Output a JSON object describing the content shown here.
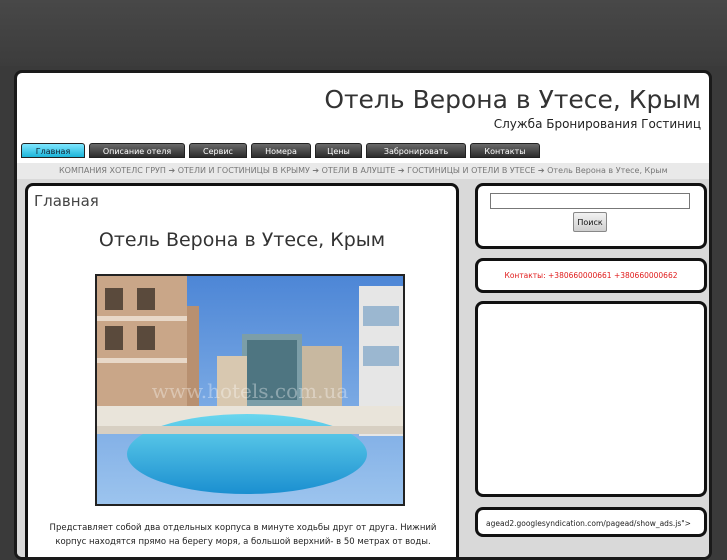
{
  "header": {
    "title": "Отель Верона в Утесе, Крым",
    "subtitle": "Служба Бронирования Гостиниц"
  },
  "nav": {
    "items": [
      {
        "label": "Главная",
        "active": true
      },
      {
        "label": "Описание отеля",
        "active": false
      },
      {
        "label": "Сервис",
        "active": false
      },
      {
        "label": "Номера",
        "active": false
      },
      {
        "label": "Цены",
        "active": false
      },
      {
        "label": "Забронировать",
        "active": false
      },
      {
        "label": "Контакты",
        "active": false
      }
    ]
  },
  "breadcrumb": {
    "text": "КОМПАНИЯ ХОТЕЛС ГРУП  ➔ ОТЕЛИ И ГОСТИНИЦЫ В КРЫМУ  ➔ ОТЕЛИ В АЛУШТЕ ➔ ГОСТИНИЦЫ И ОТЕЛИ В УТЕСЕ ➔ Отель Верона в Утесе, Крым"
  },
  "main": {
    "heading": "Главная",
    "hotel_title": "Отель Верона в Утесе, Крым",
    "photo_watermark": "www.hotels.com.ua",
    "description": "Представляет собой два отдельных корпуса в минуте ходьбы друг от друга. Нижний корпус находятся прямо на берегу моря, а большой верхний- в 50 метрах от воды."
  },
  "sidebar": {
    "search_button": "Поиск",
    "search_value": "",
    "contacts": "Контакты: +380660000661 +380660000662",
    "script_text": "agead2.googlesyndication.com/pagead/show_ads.js\">"
  },
  "colors": {
    "background": "#3a3a3a",
    "active_tab": "#1cb4d8",
    "contacts_text": "#e01b1b"
  }
}
